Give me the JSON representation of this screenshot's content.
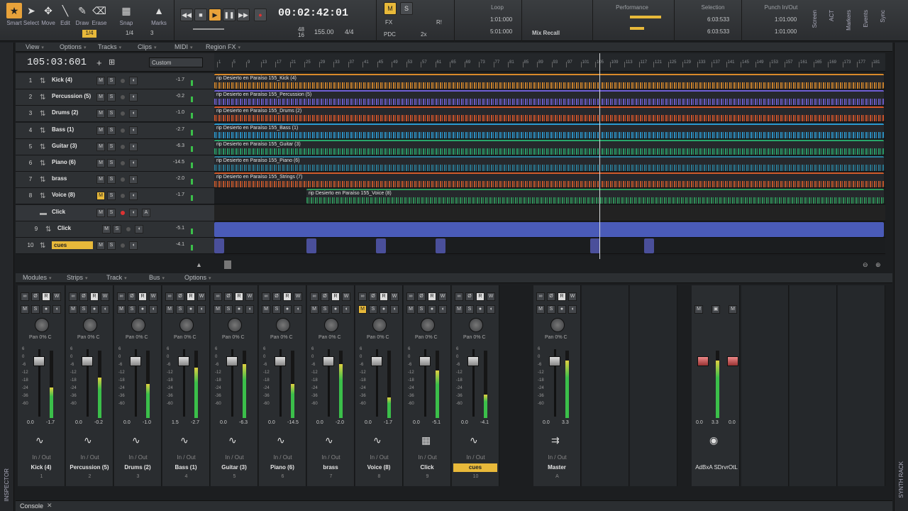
{
  "toolbar": {
    "tools": [
      {
        "label": "Smart",
        "icon": "star-icon"
      },
      {
        "label": "Select",
        "icon": "arrow-icon"
      },
      {
        "label": "Move",
        "icon": "move-icon"
      },
      {
        "label": "Edit",
        "icon": "edit-icon"
      },
      {
        "label": "Draw",
        "icon": "pencil-icon"
      },
      {
        "label": "Erase",
        "icon": "eraser-icon"
      }
    ],
    "snap_label": "Snap",
    "marks_label": "Marks",
    "snap_value": "1/4",
    "snap_res": "1/4",
    "snap_num": "3",
    "time": "00:02:42:01",
    "tempo": "155.00",
    "meter": "4/4",
    "sig_top": "48",
    "sig_bottom": "16",
    "loop_label": "Loop",
    "loop_start": "1:01:000",
    "loop_end": "5:01:000",
    "mix_recall": "Mix Recall",
    "performance_label": "Performance",
    "selection_label": "Selection",
    "selection_start": "6:03:533",
    "selection_end": "6:03:533",
    "punch_label": "Punch In/Out",
    "punch_start": "1:01:000",
    "punch_end": "1:01:000",
    "m_label": "M",
    "s_label": "S",
    "fx_label": "FX",
    "pdc_label": "PDC",
    "r_label": "R!",
    "twox_label": "2x",
    "screen_label": "Screen",
    "act_label": "ACT",
    "markers_label": "Markers",
    "events_label": "Events",
    "sync_label": "Sync"
  },
  "track_menu": [
    "View",
    "Options",
    "Tracks",
    "Clips",
    "MIDI",
    "Region FX"
  ],
  "now_time": "105:03:601",
  "custom_label": "Custom",
  "ruler_ticks": [
    "1",
    "5",
    "9",
    "13",
    "17",
    "21",
    "25",
    "29",
    "33",
    "37",
    "41",
    "45",
    "49",
    "53",
    "57",
    "61",
    "65",
    "69",
    "73",
    "77",
    "81",
    "85",
    "89",
    "93",
    "97",
    "101",
    "105",
    "109",
    "113",
    "117",
    "121",
    "125",
    "129",
    "133",
    "137",
    "141",
    "145",
    "149",
    "153",
    "157",
    "161",
    "165",
    "169",
    "173",
    "177",
    "181"
  ],
  "tracks": [
    {
      "num": "1",
      "name": "Kick (4)",
      "vol": "-1.7",
      "color": "#d8892a",
      "clip": "rip Desierto en Paraíso 155_Kick (4)",
      "mute": false
    },
    {
      "num": "2",
      "name": "Percussion (5)",
      "vol": "-0.2",
      "color": "#6f5fd4",
      "clip": "rip Desierto en Paraíso 155_Percussion (5)",
      "mute": false
    },
    {
      "num": "3",
      "name": "Drums (2)",
      "vol": "-1.0",
      "color": "#d9562a",
      "clip": "rip Desierto en Paraíso 155_Drums (2)",
      "mute": false
    },
    {
      "num": "4",
      "name": "Bass (1)",
      "vol": "-2.7",
      "color": "#2a9ad0",
      "clip": "rip Desierto en Paraíso 155_Bass (1)",
      "mute": false
    },
    {
      "num": "5",
      "name": "Guitar (3)",
      "vol": "-6.3",
      "color": "#28a56a",
      "clip": "rip Desierto en Paraíso 155_Guitar (3)",
      "mute": false
    },
    {
      "num": "6",
      "name": "Piano (6)",
      "vol": "-14.5",
      "color": "#2a7f9a",
      "clip": "rip Desierto en Paraíso 155_Piano (6)",
      "mute": false
    },
    {
      "num": "7",
      "name": "brass",
      "vol": "-2.0",
      "color": "#cf5a2a",
      "clip": "rip Desierto en Paraíso 155_Strings (7)",
      "mute": false
    },
    {
      "num": "8",
      "name": "Voice (8)",
      "vol": "-1.7",
      "color": "#2f9a5a",
      "clip": "rip Desierto en Paraíso 155_Voice (8)",
      "mute": true
    }
  ],
  "click_folder": {
    "name": "Click"
  },
  "click_track": {
    "num": "9",
    "name": "Click",
    "vol": "-5.1"
  },
  "cues_track": {
    "num": "10",
    "name": "cues",
    "vol": "-4.1"
  },
  "mixer_menu": [
    "Modules",
    "Strips",
    "Track",
    "Bus",
    "Options"
  ],
  "strips": [
    {
      "name": "Kick (4)",
      "num": "1",
      "left": "0.0",
      "right": "-1.7",
      "meter": 0.45,
      "highlight": false
    },
    {
      "name": "Percussion (5)",
      "num": "2",
      "left": "0.0",
      "right": "-0.2",
      "meter": 0.6,
      "highlight": false
    },
    {
      "name": "Drums (2)",
      "num": "3",
      "left": "0.0",
      "right": "-1.0",
      "meter": 0.5,
      "highlight": false
    },
    {
      "name": "Bass (1)",
      "num": "4",
      "left": "1.5",
      "right": "-2.7",
      "meter": 0.75,
      "highlight": false
    },
    {
      "name": "Guitar (3)",
      "num": "5",
      "left": "0.0",
      "right": "-6.3",
      "meter": 0.8,
      "highlight": false
    },
    {
      "name": "Piano (6)",
      "num": "6",
      "left": "0.0",
      "right": "-14.5",
      "meter": 0.5,
      "highlight": false
    },
    {
      "name": "brass",
      "num": "7",
      "left": "0.0",
      "right": "-2.0",
      "meter": 0.8,
      "highlight": false
    },
    {
      "name": "Voice (8)",
      "num": "8",
      "left": "0.0",
      "right": "-1.7",
      "meter": 0.3,
      "highlight": false
    },
    {
      "name": "Click",
      "num": "9",
      "left": "0.0",
      "right": "-5.1",
      "meter": 0.7,
      "highlight": false
    },
    {
      "name": "cues",
      "num": "10",
      "left": "0.0",
      "right": "-4.1",
      "meter": 0.35,
      "highlight": true
    }
  ],
  "master": {
    "name": "Master",
    "num": "A",
    "left": "0.0",
    "right": "3.3",
    "meter": 0.85
  },
  "rack": {
    "name": "AdBxA SDrvrOtL",
    "left": "0.0",
    "right": "3.3",
    "r2": "0.0",
    "meter": 0.85
  },
  "pan_label": "Pan",
  "pan_value": "0% C",
  "inout_label": "In / Out",
  "scale_labels": [
    "6",
    "0",
    "-6",
    "-12",
    "-18",
    "-24",
    "-36",
    "-60"
  ],
  "console_label": "Console",
  "inspector_label": "INSPECTOR",
  "synth_rack_label": "SYNTH RACK"
}
